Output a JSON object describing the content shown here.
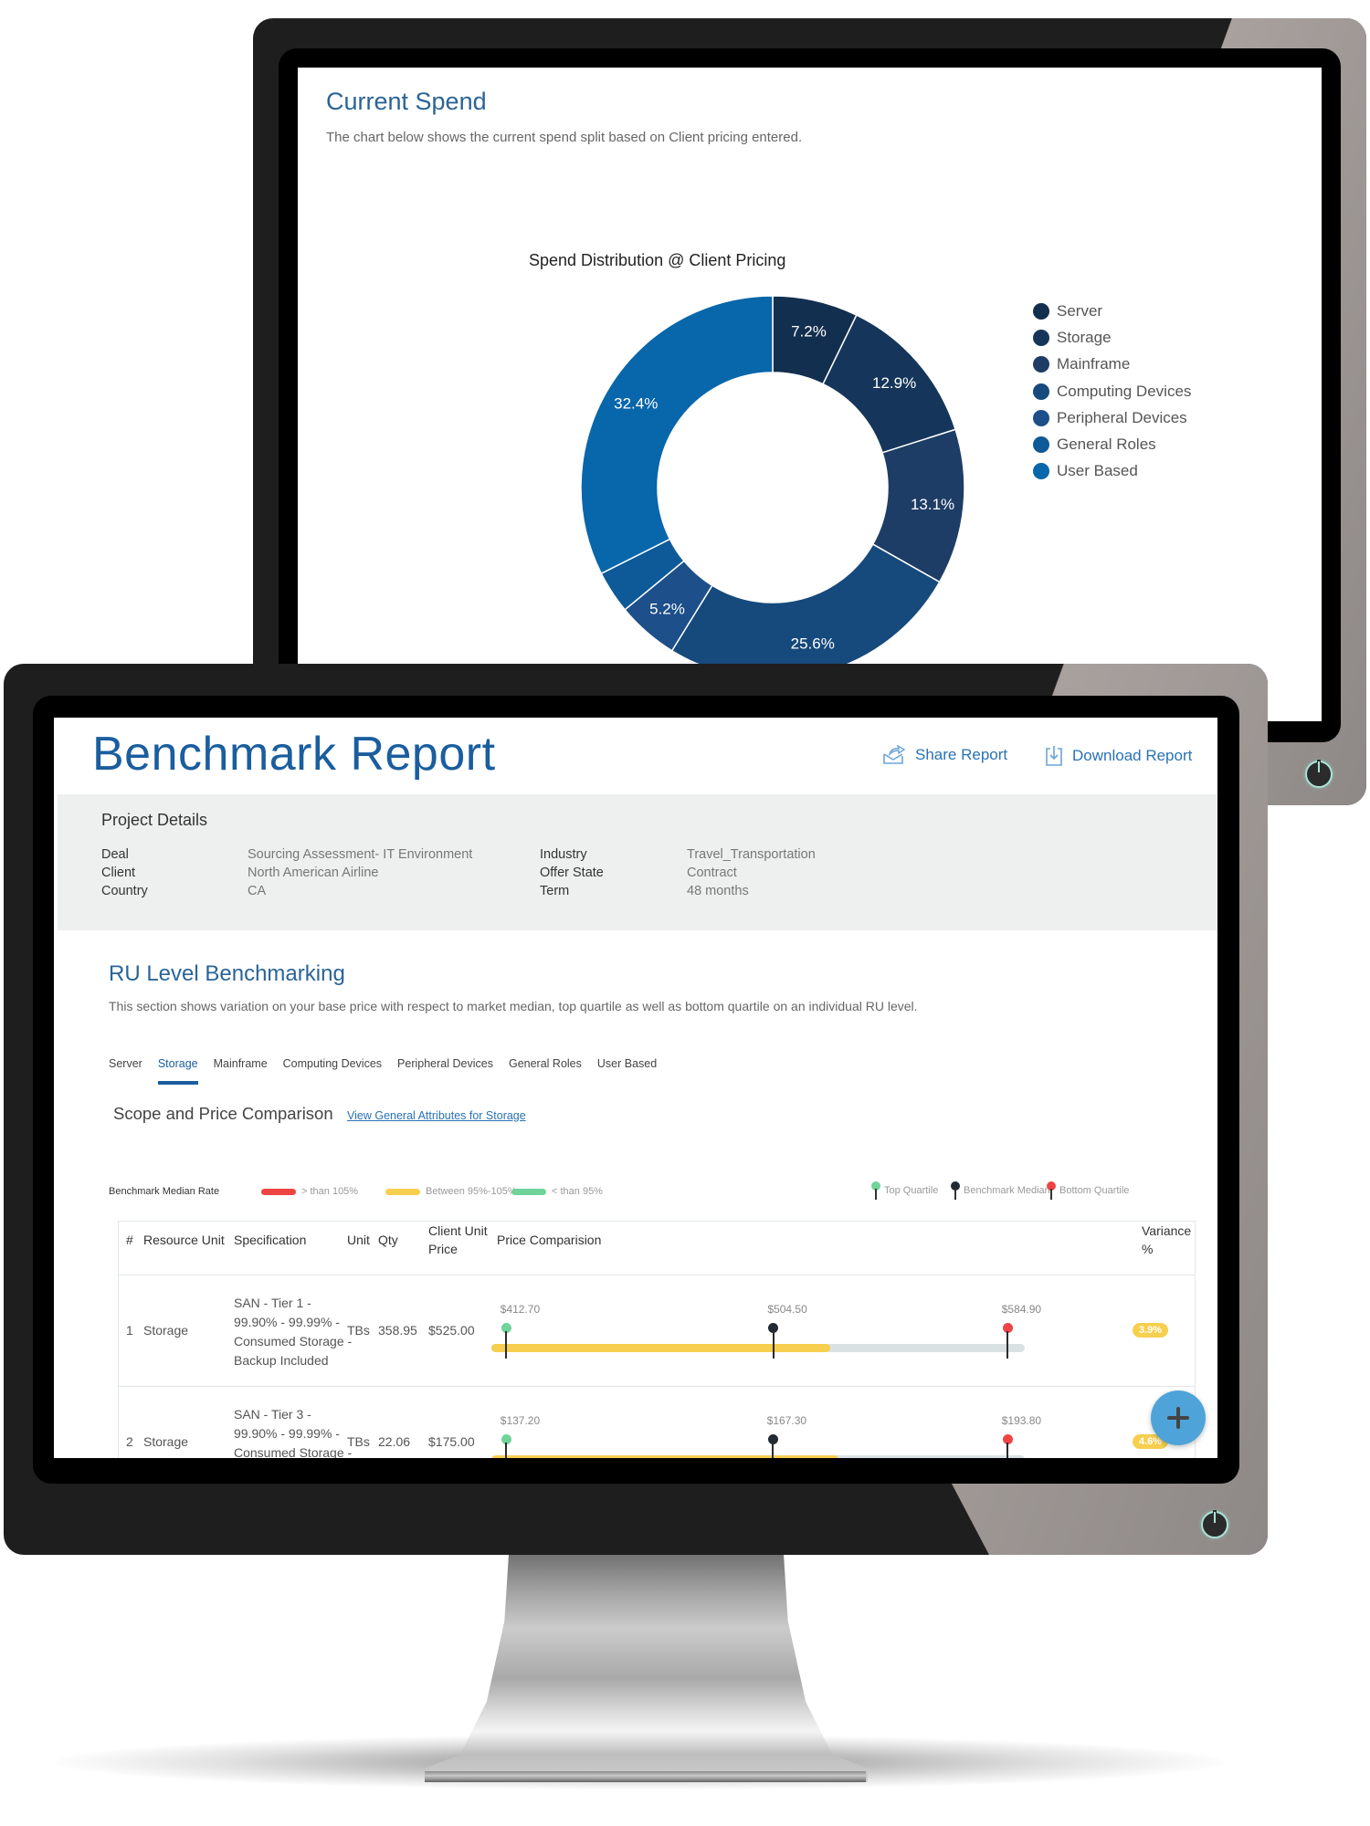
{
  "back_screen": {
    "title": "Current Spend",
    "subtitle": "The chart below shows the current spend split based on Client pricing entered.",
    "power_icon": "power-icon"
  },
  "chart_data": {
    "type": "pie",
    "variant": "donut",
    "title": "Spend Distribution @ Client Pricing",
    "legend_position": "right",
    "categories": [
      "Server",
      "Storage",
      "Mainframe",
      "Computing Devices",
      "Peripheral Devices",
      "General Roles",
      "User Based"
    ],
    "values": [
      7.2,
      12.9,
      13.1,
      25.6,
      5.2,
      3.6,
      32.4
    ],
    "labels": [
      "7.2%",
      "12.9%",
      "13.1%",
      "25.6%",
      "5.2%",
      "",
      "32.4%"
    ],
    "colors": [
      "#132f4f",
      "#15365a",
      "#1e3d66",
      "#164a7c",
      "#1d4f8a",
      "#0e5a98",
      "#0866aa"
    ],
    "unit": "%"
  },
  "front_screen": {
    "title": "Benchmark Report",
    "share_label": "Share Report",
    "download_label": "Download Report",
    "project_details": {
      "title": "Project Details",
      "left": [
        {
          "label": "Deal",
          "value": "Sourcing Assessment- IT Environment"
        },
        {
          "label": "Client",
          "value": "North American Airline"
        },
        {
          "label": "Country",
          "value": "CA"
        }
      ],
      "right": [
        {
          "label": "Industry",
          "value": "Travel_Transportation"
        },
        {
          "label": "Offer State",
          "value": "Contract"
        },
        {
          "label": "Term",
          "value": "48 months"
        }
      ]
    },
    "ru": {
      "title": "RU Level Benchmarking",
      "subtitle": "This section shows variation on your base price with respect to market median, top quartile as well as bottom quartile on an individual RU level.",
      "tabs": [
        {
          "label": "Server",
          "active": false
        },
        {
          "label": "Storage",
          "active": true
        },
        {
          "label": "Mainframe",
          "active": false
        },
        {
          "label": "Computing Devices",
          "active": false
        },
        {
          "label": "Peripheral Devices",
          "active": false
        },
        {
          "label": "General Roles",
          "active": false
        },
        {
          "label": "User Based",
          "active": false
        }
      ],
      "scope_title": "Scope and Price Comparison",
      "scope_link": "View General Attributes for Storage"
    },
    "legend": {
      "rate_label": "Benchmark Median Rate",
      "items": [
        {
          "label": "> than 105%",
          "color": "#ef4444"
        },
        {
          "label": "Between 95%-105%",
          "color": "#f7cf4e"
        },
        {
          "label": "< than 95%",
          "color": "#6fd39a"
        }
      ],
      "markers": [
        {
          "label": "Top Quartile",
          "color": "#6fd39a"
        },
        {
          "label": "Benchmark Median",
          "color": "#222b33"
        },
        {
          "label": "Bottom Quartile",
          "color": "#ef4444"
        }
      ]
    },
    "table": {
      "headers": {
        "num": "#",
        "resource_unit": "Resource Unit",
        "specification": "Specification",
        "unit": "Unit",
        "qty": "Qty",
        "client_unit_price_1": "Client Unit",
        "client_unit_price_2": "Price",
        "price_comparison": "Price Comparision",
        "variance_1": "Variance",
        "variance_2": "%"
      },
      "rows": [
        {
          "num": "1",
          "resource_unit": "Storage",
          "spec_lines": [
            "SAN - Tier 1 -",
            "99.90% - 99.99% -",
            "Consumed Storage -",
            "Backup Included"
          ],
          "unit": "TBs",
          "qty": "358.95",
          "client_unit_price": "$525.00",
          "top_quartile": "$412.70",
          "median": "$504.50",
          "bottom_quartile": "$584.90",
          "fill_fraction": 0.635,
          "fill_color": "#f7cf4e",
          "variance": "3.9%"
        },
        {
          "num": "2",
          "resource_unit": "Storage",
          "spec_lines": [
            "SAN - Tier 3 -",
            "99.90% - 99.99% -",
            "Consumed Storage -",
            ""
          ],
          "unit": "TBs",
          "qty": "22.06",
          "client_unit_price": "$175.00",
          "top_quartile": "$137.20",
          "median": "$167.30",
          "bottom_quartile": "$193.80",
          "fill_fraction": 0.65,
          "fill_color": "#f7cf4e",
          "variance": "4.6%"
        }
      ]
    },
    "fab_icon": "plus-icon"
  }
}
